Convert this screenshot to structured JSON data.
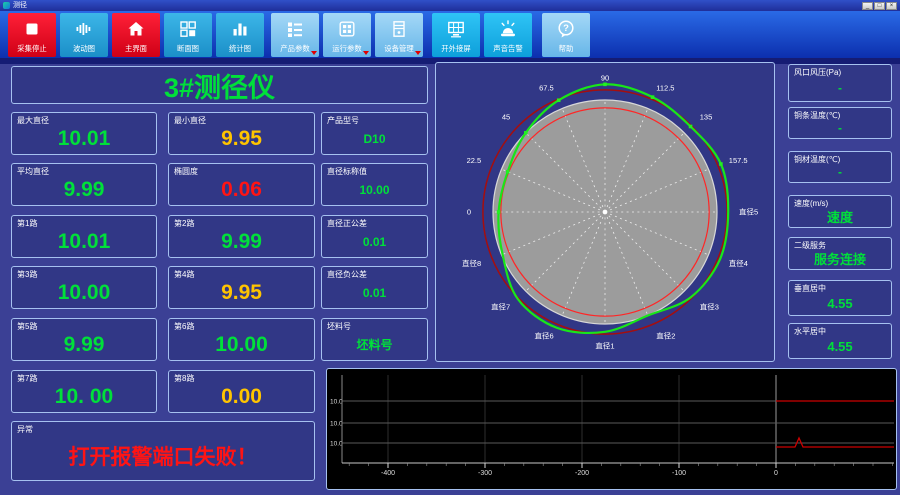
{
  "window": {
    "title": "测径",
    "minimize": "_",
    "maximize": "□",
    "close": "×"
  },
  "toolbar": {
    "buttons": [
      {
        "label": "采集停止"
      },
      {
        "label": "波动图"
      },
      {
        "label": "主界面"
      },
      {
        "label": "断面图"
      },
      {
        "label": "统计图"
      },
      {
        "label": "产品参数"
      },
      {
        "label": "运行参数"
      },
      {
        "label": "设备管理"
      },
      {
        "label": "开外接屏"
      },
      {
        "label": "声音告警"
      },
      {
        "label": "帮助"
      }
    ]
  },
  "header": {
    "title": "3#测径仪"
  },
  "metrics": {
    "max_diameter": {
      "label": "最大直径",
      "value": "10.01"
    },
    "min_diameter": {
      "label": "最小直径",
      "value": "9.95"
    },
    "product_model": {
      "label": "产品型号",
      "value": "D10"
    },
    "avg_diameter": {
      "label": "平均直径",
      "value": "9.99"
    },
    "ovality": {
      "label": "椭圆度",
      "value": "0.06"
    },
    "nominal": {
      "label": "直径标称值",
      "value": "10.00"
    },
    "path1": {
      "label": "第1路",
      "value": "10.01"
    },
    "path2": {
      "label": "第2路",
      "value": "9.99"
    },
    "tol_plus": {
      "label": "直径正公差",
      "value": "0.01"
    },
    "path3": {
      "label": "第3路",
      "value": "10.00"
    },
    "path4": {
      "label": "第4路",
      "value": "9.95"
    },
    "tol_minus": {
      "label": "直径负公差",
      "value": "0.01"
    },
    "path5": {
      "label": "第5路",
      "value": "9.99"
    },
    "path6": {
      "label": "第6路",
      "value": "10.00"
    },
    "billet": {
      "label": "坯料号",
      "value": "坯料号"
    },
    "path7": {
      "label": "第7路",
      "value": "10. 00"
    },
    "path8": {
      "label": "第8路",
      "value": "0.00"
    },
    "abnormal": {
      "label": "异常",
      "value": "打开报警端口失败！"
    }
  },
  "right_panels": {
    "air_pressure": {
      "label": "风口风压(Pa)",
      "value": "-"
    },
    "bar_temp": {
      "label": "铜条温度(℃)",
      "value": "-"
    },
    "material_temp": {
      "label": "铜材温度(℃)",
      "value": "-"
    },
    "speed": {
      "label": "速度(m/s)",
      "value": "速度"
    },
    "level2_service": {
      "label": "二级服务",
      "value": "服务连接"
    },
    "vertical_center": {
      "label": "垂直居中",
      "value": "4.55"
    },
    "horizontal_center": {
      "label": "水平居中",
      "value": "4.55"
    }
  },
  "chart_data": [
    {
      "id": "cross_section_polar",
      "type": "polar_profile",
      "angle_labels": [
        {
          "angle": 180,
          "text": "0",
          "marker": true
        },
        {
          "angle": 157.5,
          "text": "22.5",
          "marker": true
        },
        {
          "angle": 135,
          "text": "45",
          "marker": true
        },
        {
          "angle": 112.5,
          "text": "67.5",
          "marker": true
        },
        {
          "angle": 90,
          "text": "90",
          "marker": true
        },
        {
          "angle": 67.5,
          "text": "112.5",
          "marker": true
        },
        {
          "angle": 45,
          "text": "135",
          "marker": true
        },
        {
          "angle": 22.5,
          "text": "157.5",
          "marker": true
        },
        {
          "angle": 0,
          "text": "直径5",
          "marker": false
        },
        {
          "angle": 337.5,
          "text": "直径4",
          "marker": false
        },
        {
          "angle": 315,
          "text": "直径3",
          "marker": false
        },
        {
          "angle": 292.5,
          "text": "直径2",
          "marker": false
        },
        {
          "angle": 270,
          "text": "直径1",
          "marker": false
        },
        {
          "angle": 247.5,
          "text": "直径6",
          "marker": false
        },
        {
          "angle": 225,
          "text": "直径7",
          "marker": false
        },
        {
          "angle": 202.5,
          "text": "直径8",
          "marker": false
        }
      ],
      "nominal_radius": 1.0,
      "tolerance_inner_circle": 0.93,
      "tolerance_outer_circle": 1.09,
      "profile": [
        [
          0,
          1.1
        ],
        [
          22.5,
          1.12
        ],
        [
          45,
          1.08
        ],
        [
          67.5,
          1.11
        ],
        [
          90,
          1.14
        ],
        [
          112.5,
          1.08
        ],
        [
          135,
          1.0
        ],
        [
          157.5,
          0.94
        ],
        [
          180,
          0.95
        ],
        [
          202.5,
          0.99
        ],
        [
          225,
          1.1
        ],
        [
          247.5,
          1.12
        ],
        [
          270,
          1.07
        ],
        [
          292.5,
          1.0
        ],
        [
          315,
          1.08
        ],
        [
          337.5,
          1.11
        ]
      ]
    },
    {
      "id": "diameter_trend",
      "type": "line",
      "x_ticks": [
        -400,
        -300,
        -200,
        -100,
        0
      ],
      "x_range": [
        -446,
        122
      ],
      "y_gridline_labels": [
        "10.0",
        "10.0",
        "10.0"
      ],
      "series": [
        {
          "name": "upper-line",
          "color": "#cc0000",
          "x_from": 0,
          "x_to": 120,
          "gridline": 1
        },
        {
          "name": "lower-line",
          "color": "#cc0000",
          "x_from": 0,
          "x_to": 120,
          "gridline": "below-3",
          "spike_x": 24
        }
      ]
    }
  ],
  "colors": {
    "page_bg": "#3b4095",
    "panel_bg": "#313786",
    "panel_border": "#a6c1f0",
    "green": "#00e03a",
    "yellow": "#ffc400",
    "red": "#ff1414",
    "toolbar_red": "#e3001e",
    "toolbar_blue": "#29a3dc",
    "toolbar_light": "#7cc4ee",
    "toolbar_bright": "#19b5f0",
    "profile_green": "#19e619",
    "tolerance_red": "#ff2626",
    "outer_red": "#a50e0e"
  }
}
